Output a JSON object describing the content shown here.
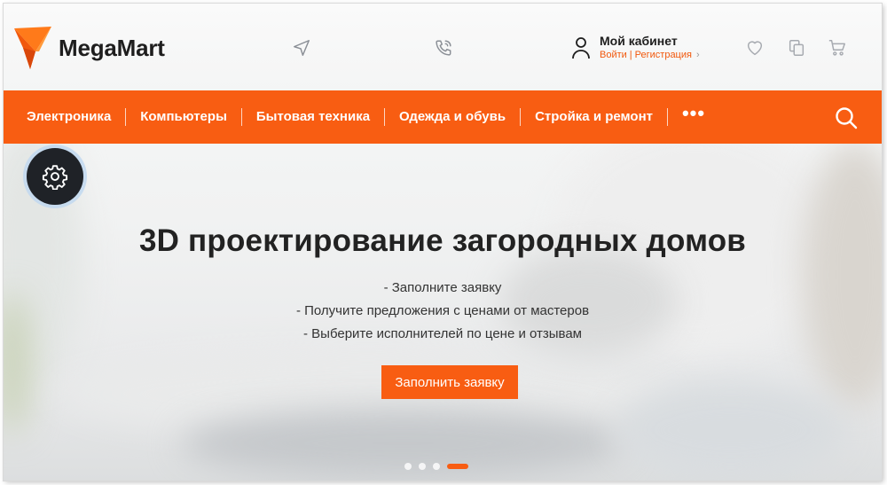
{
  "brand": {
    "name": "MegaMart",
    "accent": "#f85d12"
  },
  "header": {
    "icons": [
      "location-arrow-icon",
      "phone-icon",
      "user-icon",
      "heart-icon",
      "compare-icon",
      "cart-icon"
    ],
    "account": {
      "title": "Мой кабинет",
      "login": "Войти",
      "separator": "|",
      "register": "Регистрация",
      "arrow": "›"
    }
  },
  "nav": {
    "items": [
      {
        "label": "Электроника"
      },
      {
        "label": "Компьютеры"
      },
      {
        "label": "Бытовая техника"
      },
      {
        "label": "Одежда и обувь"
      },
      {
        "label": "Стройка и ремонт"
      }
    ],
    "more": "•••"
  },
  "hero": {
    "title": "3D проектирование загородных домов",
    "bullets": [
      "- Заполните заявку",
      "- Получите предложения с ценами от мастеров",
      "- Выберите исполнителей по цене и отзывам"
    ],
    "cta": "Заполнить заявку"
  },
  "slider": {
    "total": 4,
    "active": 3
  }
}
